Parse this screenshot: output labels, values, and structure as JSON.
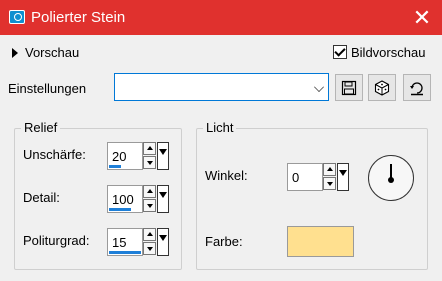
{
  "window": {
    "title": "Polierter Stein",
    "app_icon": "camera-icon",
    "close_glyph": "✕",
    "accent_color": "#e0312e"
  },
  "preview": {
    "toggle_label": "Vorschau",
    "bild_label": "Bildvorschau",
    "bild_checked": true
  },
  "settings": {
    "label": "Einstellungen",
    "preset_value": "",
    "icons": [
      "save-icon",
      "dice-icon",
      "reset-icon"
    ]
  },
  "relief": {
    "title": "Relief",
    "blur_label": "Unschärfe:",
    "blur_value": "20",
    "detail_label": "Detail:",
    "detail_value": "100",
    "polish_label": "Politurgrad:",
    "polish_value": "15"
  },
  "light": {
    "title": "Licht",
    "angle_label": "Winkel:",
    "angle_value": "0",
    "color_label": "Farbe:",
    "color_hex": "#ffe08f"
  }
}
